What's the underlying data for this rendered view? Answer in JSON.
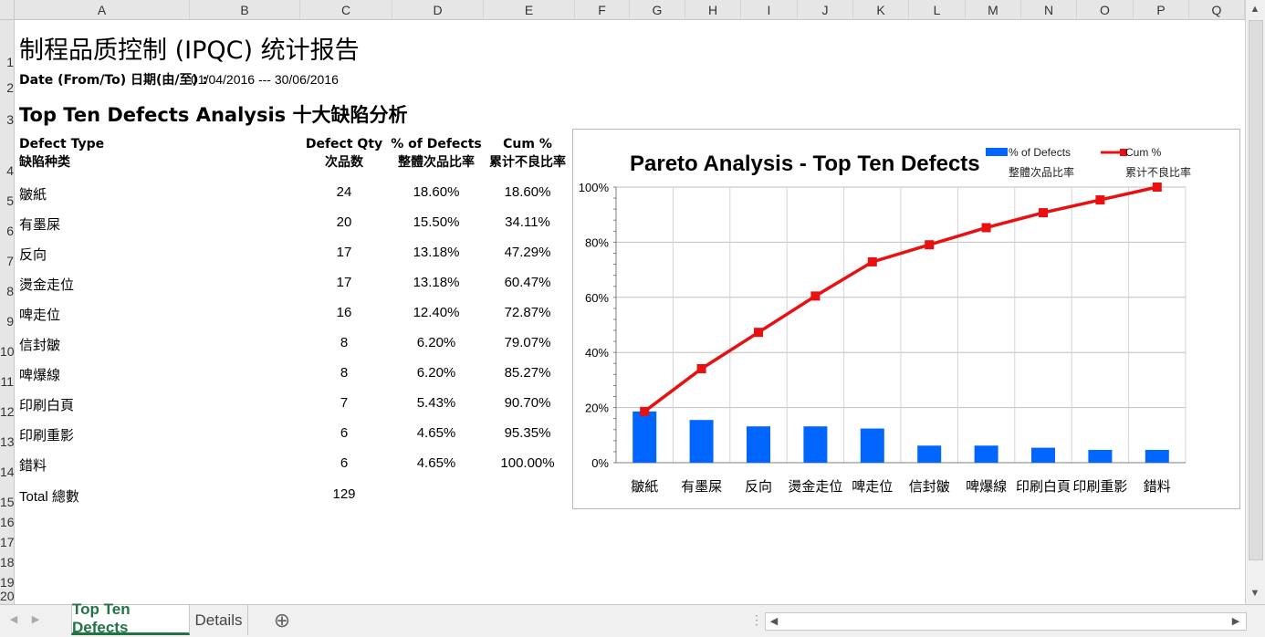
{
  "columns": [
    "A",
    "B",
    "C",
    "D",
    "E",
    "F",
    "G",
    "H",
    "I",
    "J",
    "K",
    "L",
    "M",
    "N",
    "O",
    "P",
    "Q"
  ],
  "rows": [
    "1",
    "2",
    "3",
    "4",
    "5",
    "6",
    "7",
    "8",
    "9",
    "10",
    "11",
    "12",
    "13",
    "14",
    "15",
    "16",
    "17",
    "18",
    "19",
    "20"
  ],
  "report": {
    "title": "制程品质控制 (IPQC) 统计报告",
    "date_label": "Date (From/To) 日期(由/至) :",
    "date_value": "01/04/2016 --- 30/06/2016",
    "section_title": "Top Ten Defects Analysis 十大缺陷分析"
  },
  "table": {
    "headers": {
      "type_en": "Defect Type",
      "type_cn": "缺陷种类",
      "qty_en": "Defect Qty",
      "qty_cn": "次品数",
      "pct_en": "% of Defects",
      "pct_cn": "整體次品比率",
      "cum_en": "Cum %",
      "cum_cn": "累计不良比率"
    },
    "rows": [
      {
        "type": "皺紙",
        "qty": "24",
        "pct": "18.60%",
        "cum": "18.60%"
      },
      {
        "type": "有墨屎",
        "qty": "20",
        "pct": "15.50%",
        "cum": "34.11%"
      },
      {
        "type": "反向",
        "qty": "17",
        "pct": "13.18%",
        "cum": "47.29%"
      },
      {
        "type": "燙金走位",
        "qty": "17",
        "pct": "13.18%",
        "cum": "60.47%"
      },
      {
        "type": "啤走位",
        "qty": "16",
        "pct": "12.40%",
        "cum": "72.87%"
      },
      {
        "type": "信封皺",
        "qty": "8",
        "pct": "6.20%",
        "cum": "79.07%"
      },
      {
        "type": "啤爆線",
        "qty": "8",
        "pct": "6.20%",
        "cum": "85.27%"
      },
      {
        "type": "印刷白頁",
        "qty": "7",
        "pct": "5.43%",
        "cum": "90.70%"
      },
      {
        "type": "印刷重影",
        "qty": "6",
        "pct": "4.65%",
        "cum": "95.35%"
      },
      {
        "type": "錯料",
        "qty": "6",
        "pct": "4.65%",
        "cum": "100.00%"
      }
    ],
    "total_label": "Total 總數",
    "total_value": "129"
  },
  "chart_data": {
    "type": "bar",
    "title": "Pareto Analysis - Top Ten Defects",
    "categories": [
      "皺紙",
      "有墨屎",
      "反向",
      "燙金走位",
      "啤走位",
      "信封皺",
      "啤爆線",
      "印刷白頁",
      "印刷重影",
      "錯料"
    ],
    "series": [
      {
        "name": "% of Defects",
        "name_cn": "整體次品比率",
        "type": "bar",
        "color": "#0066ff",
        "values": [
          18.6,
          15.5,
          13.18,
          13.18,
          12.4,
          6.2,
          6.2,
          5.43,
          4.65,
          4.65
        ]
      },
      {
        "name": "Cum %",
        "name_cn": "累计不良比率",
        "type": "line",
        "color": "#e81010",
        "values": [
          18.6,
          34.11,
          47.29,
          60.47,
          72.87,
          79.07,
          85.27,
          90.7,
          95.35,
          100.0
        ]
      }
    ],
    "ylim": [
      0,
      100
    ],
    "yticks": [
      "0%",
      "20%",
      "40%",
      "60%",
      "80%",
      "100%"
    ],
    "grid": true,
    "legend_position": "top-right"
  },
  "sheet_tabs": {
    "active": "Top Ten Defects",
    "other": "Details",
    "add_symbol": "⊕"
  },
  "colors": {
    "accent": "#217346",
    "bar": "#0066ff",
    "line": "#e81010"
  }
}
